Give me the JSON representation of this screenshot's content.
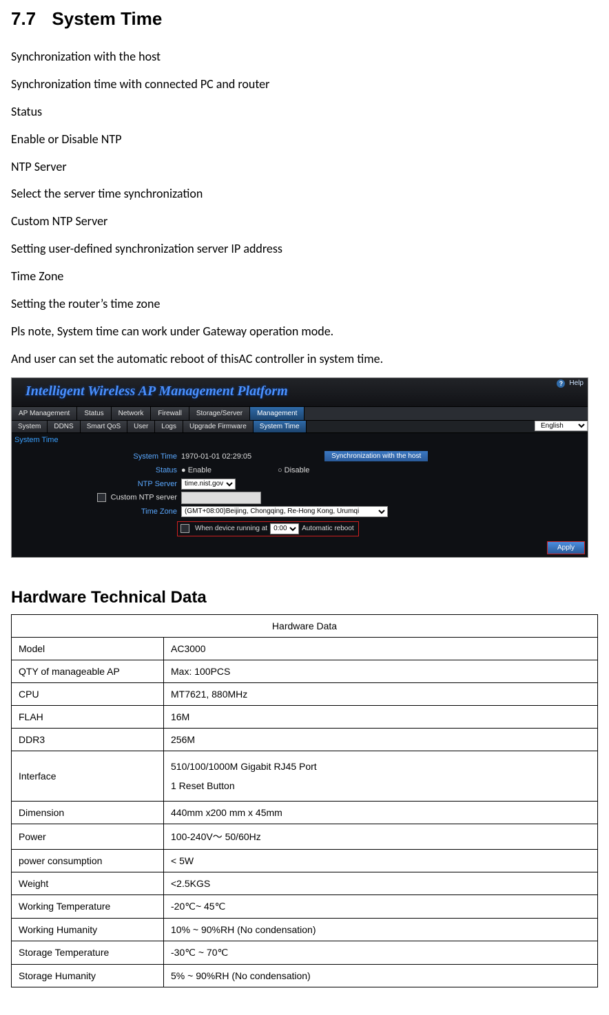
{
  "section_number": "7.7",
  "section_title": "System Time",
  "paragraphs": [
    "Synchronization with the host",
    "Synchronization time with connected PC and router",
    "Status",
    "Enable or Disable NTP",
    "NTP Server",
    "Select the server time synchronization",
    "Custom NTP Server",
    "Setting user-defined synchronization server IP address",
    "Time Zone",
    "Setting the router’s time zone",
    "Pls note, System time can work under Gateway operation mode.",
    "And user can set the automatic reboot of thisAC controller in system time."
  ],
  "screenshot": {
    "banner": "Intelligent Wireless AP Management Platform",
    "tabs_main": [
      "AP Management",
      "Status",
      "Network",
      "Firewall",
      "Storage/Server",
      "Management"
    ],
    "tabs_main_active": 5,
    "tabs_sub": [
      "System",
      "DDNS",
      "Smart QoS",
      "User",
      "Logs",
      "Upgrade Firmware",
      "System Time"
    ],
    "tabs_sub_active": 6,
    "help_label": "Help",
    "language": "English",
    "section_label": "System Time",
    "rows": {
      "system_time_label": "System Time",
      "system_time_value": "1970-01-01 02:29:05",
      "sync_button": "Synchronization with the host",
      "status_label": "Status",
      "status_enable": "Enable",
      "status_disable": "Disable",
      "ntp_label": "NTP Server",
      "ntp_value": "time.nist.gov",
      "custom_ntp_label": "Custom NTP server",
      "tz_label": "Time Zone",
      "tz_value": "(GMT+08:00)Beijing, Chongqing, Re-Hong Kong, Urumqi",
      "reboot_prefix": "When device running at",
      "reboot_time": "0:00",
      "reboot_suffix": "Automatic reboot"
    },
    "apply_label": "Apply"
  },
  "hardware_heading": "Hardware Technical Data",
  "hardware_table_header": "Hardware Data",
  "hardware_rows": [
    {
      "k": "Model",
      "v": "AC3000"
    },
    {
      "k": "QTY of manageable AP",
      "v": "Max: 100PCS"
    },
    {
      "k": "CPU",
      "v": "MT7621, 880MHz"
    },
    {
      "k": "FLAH",
      "v": "16M"
    },
    {
      "k": "DDR3",
      "v": "256M"
    },
    {
      "k": "Interface",
      "v": "510/100/1000M Gigabit RJ45 Port\n1 Reset Button"
    },
    {
      "k": "Dimension",
      "v": "440mm x200 mm x 45mm"
    },
    {
      "k": "Power",
      "v": "100-240V～ 50/60Hz"
    },
    {
      "k": "power consumption",
      "v": "< 5W"
    },
    {
      "k": "Weight",
      "v": "<2.5KGS"
    },
    {
      "k": "Working Temperature",
      "v": "-20℃~ 45℃"
    },
    {
      "k": "Working Humanity",
      "v": "10% ~ 90%RH (No condensation)"
    },
    {
      "k": "Storage Temperature",
      "v": "-30℃ ~ 70℃"
    },
    {
      "k": "Storage Humanity",
      "v": "5% ~ 90%RH (No condensation)"
    }
  ]
}
